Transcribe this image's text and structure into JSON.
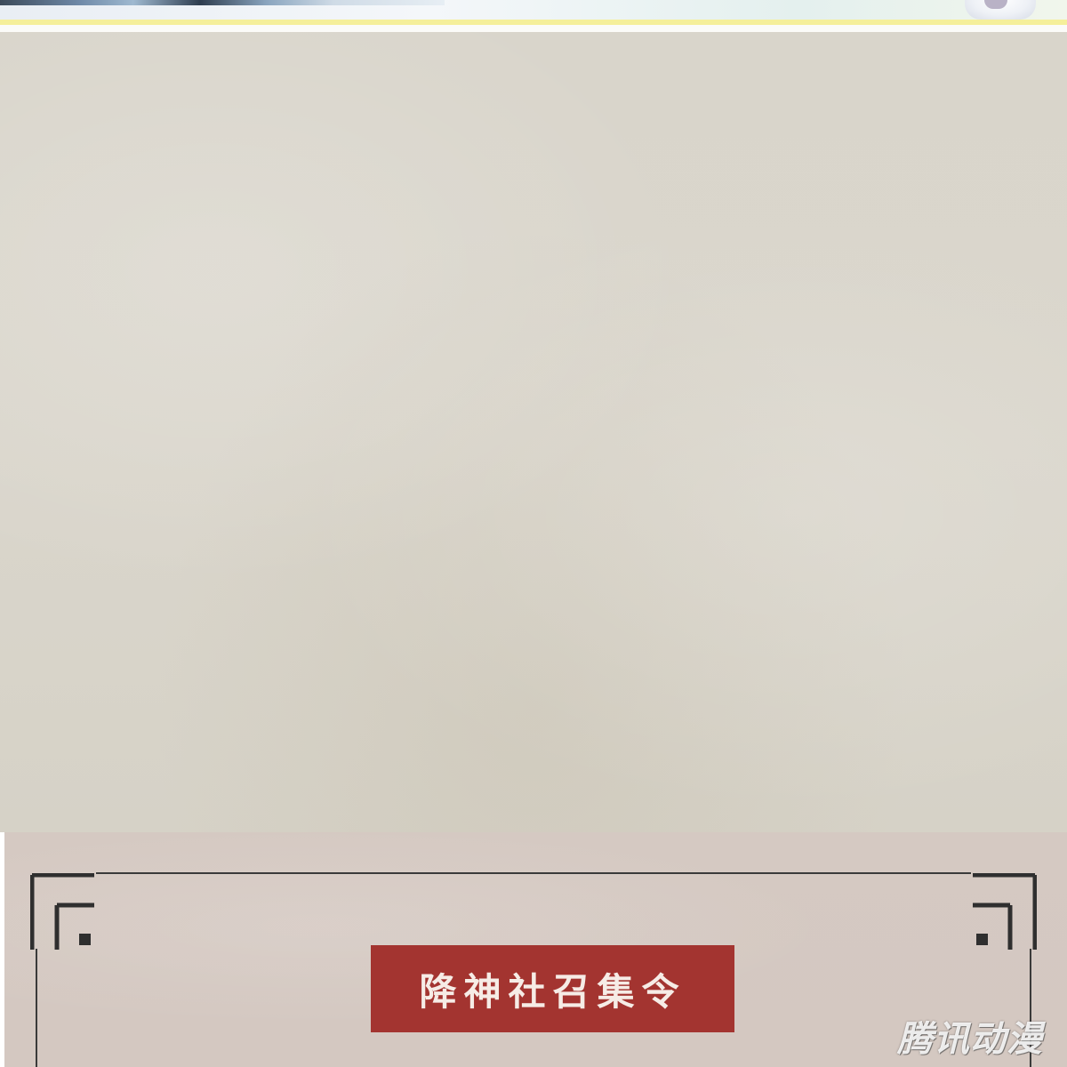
{
  "notice": {
    "title": "降神社召集令"
  },
  "watermark": {
    "text": "腾讯动漫"
  },
  "colors": {
    "parchment": "#d9d5cb",
    "notice_panel": "#d5c9c2",
    "title_box": "#a33430",
    "title_text": "#f6ece6",
    "frame": "#3a3a3a",
    "top_yellow_line": "#f5ef9a"
  }
}
